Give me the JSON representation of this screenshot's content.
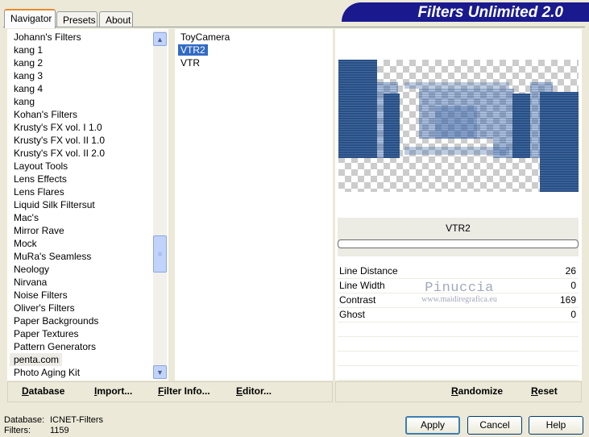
{
  "tabs": [
    "Navigator",
    "Presets",
    "About"
  ],
  "banner": "Filters Unlimited 2.0",
  "categories": [
    "Johann's Filters",
    "kang 1",
    "kang 2",
    "kang 3",
    "kang 4",
    "kang",
    "Kohan's Filters",
    "Krusty's FX vol. I 1.0",
    "Krusty's FX vol. II 1.0",
    "Krusty's FX vol. II 2.0",
    "Layout Tools",
    "Lens Effects",
    "Lens Flares",
    "Liquid Silk Filtersut",
    "Mac's",
    "Mirror Rave",
    "Mock",
    "MuRa's Seamless",
    "Neology",
    "Nirvana",
    "Noise Filters",
    "Oliver's Filters",
    "Paper Backgrounds",
    "Paper Textures",
    "Pattern Generators",
    "penta.com",
    "Photo Aging Kit"
  ],
  "selected_category": "penta.com",
  "filters": [
    "ToyCamera",
    "VTR2",
    "VTR"
  ],
  "selected_filter": "VTR2",
  "filter_name": "VTR2",
  "progress": 0,
  "params": [
    {
      "label": "Line Distance",
      "value": "26"
    },
    {
      "label": "Line Width",
      "value": "0"
    },
    {
      "label": "Contrast",
      "value": "169"
    },
    {
      "label": "Ghost",
      "value": "0"
    }
  ],
  "watermark": {
    "line1": "Pinuccia",
    "line2": "www.maidiregrafica.eu"
  },
  "bottom_left": {
    "database": "Database",
    "import": "Import...",
    "filter_info": "Filter Info...",
    "editor": "Editor..."
  },
  "bottom_right": {
    "randomize": "Randomize",
    "reset": "Reset"
  },
  "status": {
    "database_label": "Database:",
    "database_value": "ICNET-Filters",
    "filters_label": "Filters:",
    "filters_value": "1159"
  },
  "buttons": {
    "apply": "Apply",
    "cancel": "Cancel",
    "help": "Help"
  },
  "colors": {
    "banner": "#1a1a8e",
    "selection": "#316ac5",
    "tab_accent": "#e68b2c"
  },
  "icons": {
    "scroll_up": "scroll-up-arrow-icon",
    "scroll_down": "scroll-down-arrow-icon",
    "scroll_thumb": "scroll-thumb-grip-icon"
  }
}
